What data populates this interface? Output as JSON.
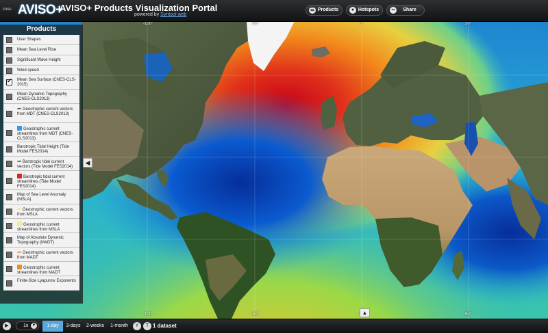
{
  "header": {
    "cnes": "cnes",
    "logo": "AVISO+",
    "title": "AVISO+ Products Visualization Portal",
    "subtitle_prefix": "powered by",
    "subtitle_brand": "Syntool web",
    "buttons": [
      {
        "label": "Products",
        "icon": "layers-icon"
      },
      {
        "label": "Hotspots",
        "icon": "map-pin-icon"
      },
      {
        "label": "Share",
        "icon": "link-icon"
      }
    ]
  },
  "panel": {
    "title": "Products",
    "items": [
      {
        "label": "User Shapes",
        "checked": false
      },
      {
        "label": "Mean Sea Level Rise",
        "checked": false
      },
      {
        "label": "Significant Wave Height",
        "checked": false
      },
      {
        "label": "Wind speed",
        "checked": false
      },
      {
        "label": "Mean Sea Surface (CNES-CLS-2015)",
        "checked": true
      },
      {
        "label": "Mean Dynamic Topography (CNES-CLS2013)",
        "checked": false
      },
      {
        "label": "Geostrophic current vectors from MDT (CNES-CLS2013)",
        "checked": false,
        "marker": "arrow",
        "color": "#555555"
      },
      {
        "label": "Geostrophic current streamlines from MDT (CNES-CLS2013)",
        "checked": false,
        "marker": "square",
        "color": "#3399ee"
      },
      {
        "label": "Barotropic Tidal Height (Tide Model FES2014)",
        "checked": false
      },
      {
        "label": "Barotropic tidal current vectors (Tide Model FES2014)",
        "checked": false,
        "marker": "arrow",
        "color": "#555555"
      },
      {
        "label": "Barotropic tidal current streamlines (Tide Model FES2014)",
        "checked": false,
        "marker": "square",
        "color": "#dd2222"
      },
      {
        "label": "Map of Sea Level Anomaly (MSLA)",
        "checked": false
      },
      {
        "label": "Geostrophic current vectors from MSLA",
        "checked": false,
        "marker": "arrow",
        "color": "#f0e060"
      },
      {
        "label": "Geostrophic current streamlines from MSLA",
        "checked": false,
        "marker": "square",
        "color": "#f5e98a"
      },
      {
        "label": "Map of Absolute Dynamic Topography (MADT)",
        "checked": false
      },
      {
        "label": "Geostrophic current vectors from MADT",
        "checked": false,
        "marker": "arrow",
        "color": "#c88a20"
      },
      {
        "label": "Geostrophic current streamlines from MADT",
        "checked": false,
        "marker": "square",
        "color": "#e89020"
      },
      {
        "label": "Finite-Size Lyapunov Exponents",
        "checked": false
      }
    ]
  },
  "map": {
    "graticule_labels": [
      "-100°",
      "-50°",
      "0°",
      "50°",
      "-100°",
      "-50°",
      "0°",
      "50°"
    ]
  },
  "bottom": {
    "speed": "1x",
    "tabs": [
      "1-day",
      "3-days",
      "2-weeks",
      "1-month"
    ],
    "active_tab": "1-day",
    "dataset": "1 dataset"
  }
}
